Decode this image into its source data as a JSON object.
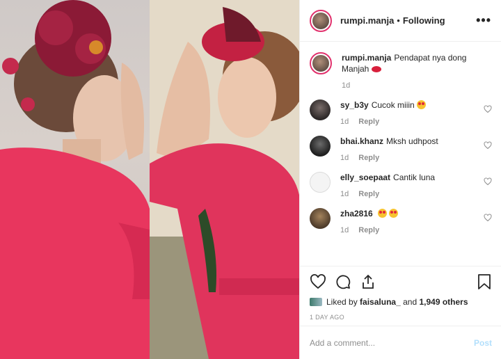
{
  "post": {
    "username": "rumpi.manja",
    "separator": "•",
    "follow_status": "Following",
    "more_label": "•••"
  },
  "caption": {
    "username": "rumpi.manja",
    "text": "Pendapat nya dong Manjah",
    "emoji": "lips-icon",
    "time": "1d"
  },
  "comments": [
    {
      "username": "sy_b3y",
      "text": "Cucok miiin",
      "emoji": "heart-eyes-emoji",
      "time": "1d",
      "reply": "Reply"
    },
    {
      "username": "bhai.khanz",
      "text": "Mksh udhpost",
      "time": "1d",
      "reply": "Reply"
    },
    {
      "username": "elly_soepaat",
      "text": "Cantik luna",
      "time": "1d",
      "reply": "Reply"
    },
    {
      "username": "zha2816",
      "text": "",
      "emoji": "heart-eyes-emoji",
      "time": "1d",
      "reply": "Reply"
    }
  ],
  "likes": {
    "prefix": "Liked by",
    "user": "faisaluna_",
    "middle": "and",
    "count": "1,949 others"
  },
  "timestamp": "1 DAY AGO",
  "add_comment": {
    "placeholder": "Add a comment...",
    "post_label": "Post"
  },
  "colors": {
    "accent_link": "#b2dffc",
    "story_ring": "#e1306c",
    "dress_pink": "#e0345c"
  }
}
